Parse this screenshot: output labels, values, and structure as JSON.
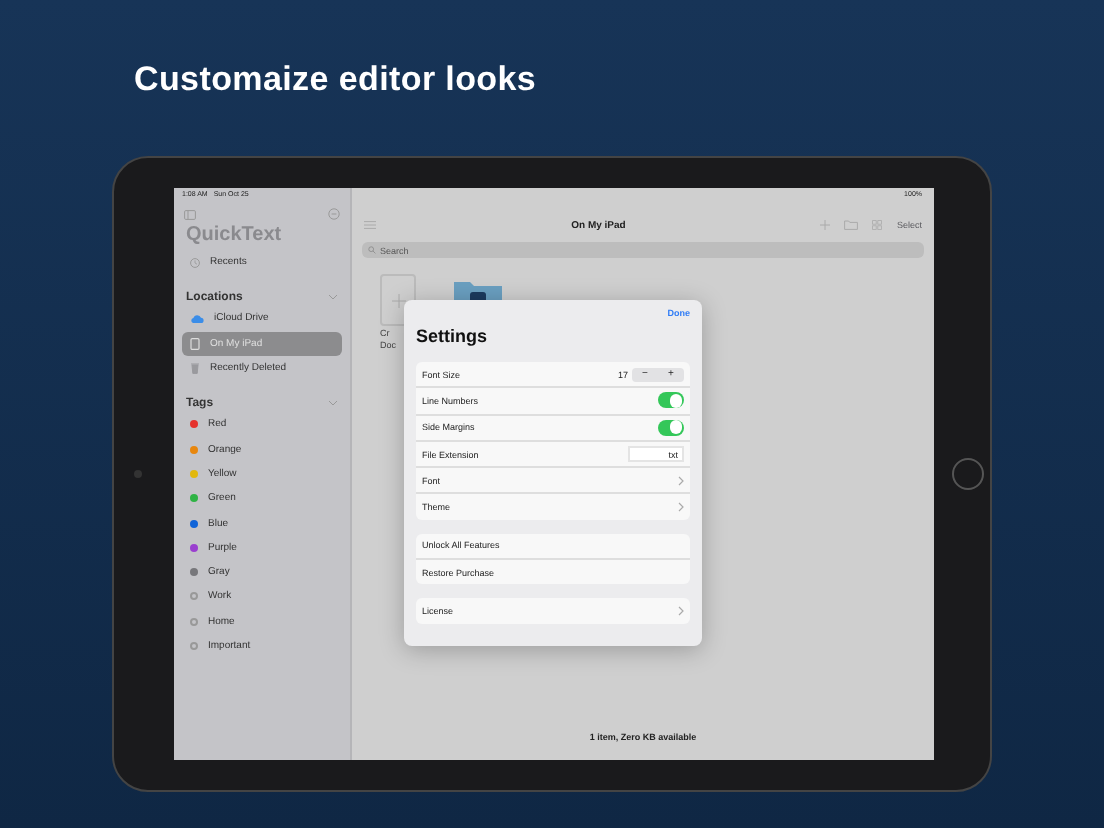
{
  "headline": "Customaize editor looks",
  "status_bar": {
    "time": "1:08 AM",
    "date": "Sun Oct 25",
    "battery": "100%"
  },
  "sidebar": {
    "title": "QuickText",
    "recents": "Recents",
    "sections": [
      {
        "title": "Locations",
        "expanded": true,
        "items": [
          {
            "label": "iCloud Drive",
            "kind": "cloud",
            "selected": false
          },
          {
            "label": "On My iPad",
            "kind": "device",
            "selected": true
          },
          {
            "label": "Recently Deleted",
            "kind": "trash",
            "selected": false
          }
        ]
      },
      {
        "title": "Tags",
        "expanded": true,
        "items": [
          {
            "label": "Red",
            "kind": "tag",
            "color": "#e5322d",
            "selected": false
          },
          {
            "label": "Orange",
            "kind": "tag",
            "color": "#e8870e",
            "selected": false
          },
          {
            "label": "Yellow",
            "kind": "tag",
            "color": "#e2b80d",
            "selected": false
          },
          {
            "label": "Green",
            "kind": "tag",
            "color": "#2fb345",
            "selected": false
          },
          {
            "label": "Blue",
            "kind": "tag",
            "color": "#1064d8",
            "selected": false
          },
          {
            "label": "Purple",
            "kind": "tag",
            "color": "#9a3fcf",
            "selected": false
          },
          {
            "label": "Gray",
            "kind": "tag",
            "color": "#77777b",
            "selected": false
          },
          {
            "label": "Work",
            "kind": "tag",
            "selected": false
          },
          {
            "label": "Home",
            "kind": "tag",
            "selected": false
          },
          {
            "label": "Important",
            "kind": "tag",
            "selected": false
          }
        ]
      }
    ]
  },
  "main": {
    "title": "On My iPad",
    "select": "Select",
    "search": {
      "placeholder": "Search"
    },
    "new_tile": {
      "label_lines": [
        "Cr",
        "Doc"
      ]
    },
    "footer": "1 item, Zero KB available"
  },
  "settings": {
    "done": "Done",
    "title": "Settings",
    "groups": [
      [
        {
          "kind": "stepper",
          "label": "Font Size",
          "value": "17",
          "minus": "−",
          "plus": "+"
        },
        {
          "kind": "toggle",
          "label": "Line Numbers",
          "on": true
        },
        {
          "kind": "toggle",
          "label": "Side Margins",
          "on": true
        },
        {
          "kind": "field",
          "label": "File Extension",
          "value": "txt"
        },
        {
          "kind": "link",
          "label": "Font"
        },
        {
          "kind": "link",
          "label": "Theme"
        }
      ],
      [
        {
          "kind": "plain",
          "label": "Unlock All Features"
        },
        {
          "kind": "plain",
          "label": "Restore Purchase"
        }
      ],
      [
        {
          "kind": "link",
          "label": "License"
        }
      ]
    ]
  }
}
